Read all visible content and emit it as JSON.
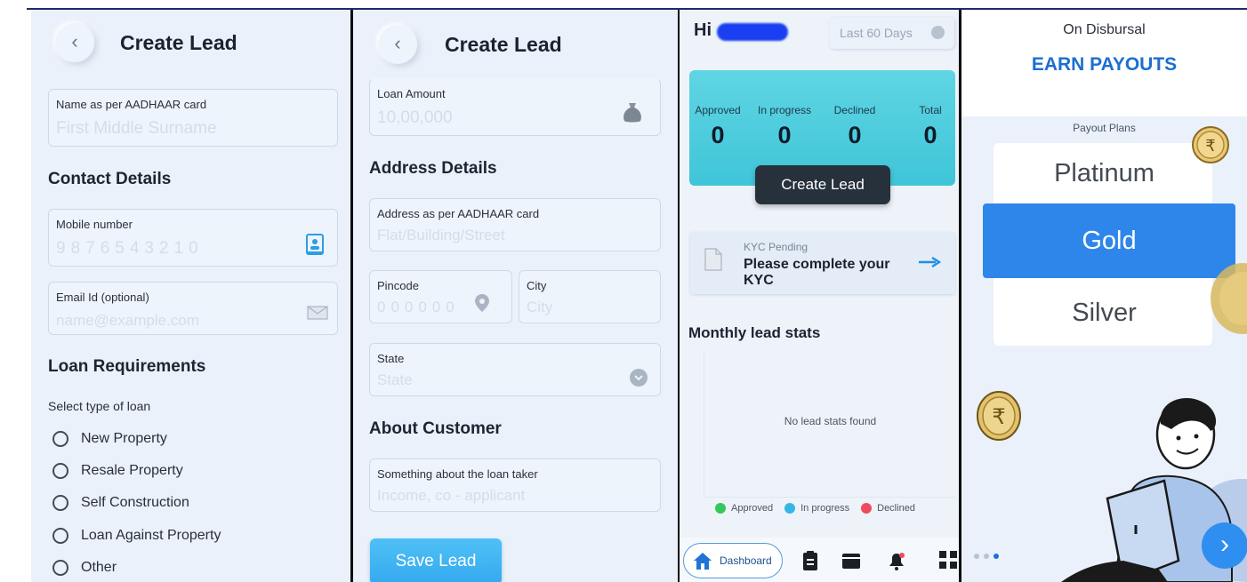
{
  "screen1": {
    "title": "Create Lead",
    "name_field": {
      "label": "Name as per AADHAAR card",
      "placeholder": "First Middle Surname"
    },
    "contact_heading": "Contact Details",
    "mobile_field": {
      "label": "Mobile number",
      "placeholder": "9876543210"
    },
    "email_field": {
      "label": "Email Id (optional)",
      "placeholder": "name@example.com"
    },
    "loan_heading": "Loan Requirements",
    "loan_type_label": "Select type of loan",
    "loan_options": [
      "New Property",
      "Resale Property",
      "Self Construction",
      "Loan Against Property",
      "Other"
    ]
  },
  "screen2": {
    "title": "Create Lead",
    "loan_amount_field": {
      "label": "Loan Amount",
      "placeholder": "10,00,000"
    },
    "address_heading": "Address Details",
    "address_field": {
      "label": "Address as per AADHAAR card",
      "placeholder": "Flat/Building/Street"
    },
    "pincode_field": {
      "label": "Pincode",
      "placeholder": "000000"
    },
    "city_field": {
      "label": "City",
      "placeholder": "City"
    },
    "state_field": {
      "label": "State",
      "placeholder": "State"
    },
    "about_heading": "About Customer",
    "about_field": {
      "label": "Something about the loan taker",
      "placeholder": "Income, co - applicant"
    },
    "save_label": "Save Lead"
  },
  "screen3": {
    "greeting": "Hi",
    "range_select": "Last 60 Days",
    "stats": [
      {
        "label": "Approved",
        "value": "0"
      },
      {
        "label": "In progress",
        "value": "0"
      },
      {
        "label": "Declined",
        "value": "0"
      },
      {
        "label": "Total",
        "value": "0"
      }
    ],
    "create_label": "Create Lead",
    "kyc_small": "KYC Pending",
    "kyc_main": "Please complete your KYC",
    "monthly_heading": "Monthly lead stats",
    "no_stats": "No lead stats found",
    "legend": [
      {
        "label": "Approved",
        "color": "#34c759"
      },
      {
        "label": "In progress",
        "color": "#35b7e6"
      },
      {
        "label": "Declined",
        "color": "#ef4b5e"
      }
    ],
    "nav_dashboard": "Dashboard"
  },
  "screen4": {
    "disbursal": "On Disbursal",
    "earn": "EARN PAYOUTS",
    "plans_label": "Payout Plans",
    "plans": [
      "Platinum",
      "Gold",
      "Silver"
    ],
    "selected_plan": "Gold"
  },
  "colors": {
    "accent": "#2f86ea",
    "teal_card": "#4ccbdc",
    "save": "#3bb0f1"
  }
}
